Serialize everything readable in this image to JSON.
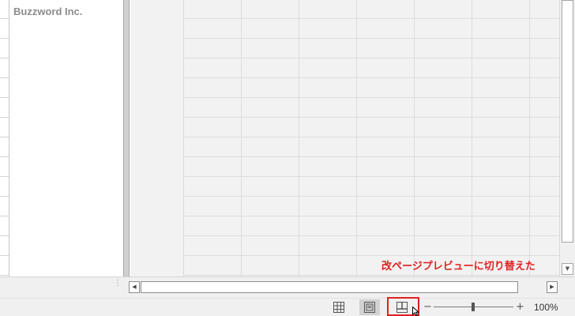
{
  "sheet": {
    "company_name": "Buzzword Inc."
  },
  "annotation": {
    "text": "改ページプレビューに切り替えた",
    "color": "#e02020"
  },
  "scrollbars": {
    "vertical_down_arrow": "▼",
    "horizontal_left_arrow": "◀",
    "horizontal_right_arrow": "▶",
    "grip": "⋮"
  },
  "statusbar": {
    "view_buttons": [
      {
        "icon": "normal-view-icon",
        "active": false
      },
      {
        "icon": "page-layout-icon",
        "active": true
      },
      {
        "icon": "page-break-preview-icon",
        "active": false,
        "highlighted": true
      }
    ],
    "zoom_minus": "−",
    "zoom_plus": "+",
    "zoom_level": "100%"
  },
  "colors": {
    "highlight": "#e02020",
    "statusbar_bg": "#f0f0f0",
    "outside_page_bg": "#f2f2f2"
  }
}
